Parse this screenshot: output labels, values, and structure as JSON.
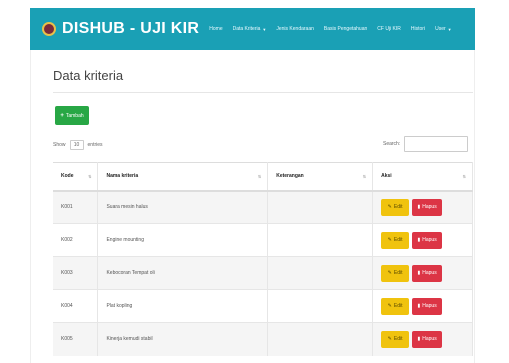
{
  "navbar": {
    "brand": "DISHUB - UJI KIR",
    "items": [
      {
        "label": "Home",
        "dropdown": false
      },
      {
        "label": "Data Kriteria",
        "dropdown": true
      },
      {
        "label": "Jenis Kendaraan",
        "dropdown": false
      },
      {
        "label": "Basis Pengetahuan",
        "dropdown": false
      },
      {
        "label": "CF Uji KIR",
        "dropdown": false
      },
      {
        "label": "Histori",
        "dropdown": false
      },
      {
        "label": "User",
        "dropdown": true
      }
    ]
  },
  "page": {
    "title": "Data kriteria",
    "add_button": "Tambah"
  },
  "table_controls": {
    "show_label": "Show",
    "entries_value": "10",
    "entries_label": "entries",
    "search_label": "Search:"
  },
  "table": {
    "headers": [
      "Kode",
      "Nama kriteria",
      "Keterangan",
      "Aksi"
    ],
    "rows": [
      {
        "kode": "K001",
        "nama": "Suara mesin halus",
        "keterangan": ""
      },
      {
        "kode": "K002",
        "nama": "Engine mounting",
        "keterangan": ""
      },
      {
        "kode": "K003",
        "nama": "Kebocoran Tempat oli",
        "keterangan": ""
      },
      {
        "kode": "K004",
        "nama": "Plat kopling",
        "keterangan": ""
      },
      {
        "kode": "K005",
        "nama": "Kinerja kemudi stabil",
        "keterangan": ""
      }
    ],
    "edit_label": "Edit",
    "delete_label": "Hapus"
  },
  "colors": {
    "navbar": "#1aa0b5",
    "add_button": "#28a745",
    "edit_button": "#f0c30e",
    "delete_button": "#dc3545"
  }
}
